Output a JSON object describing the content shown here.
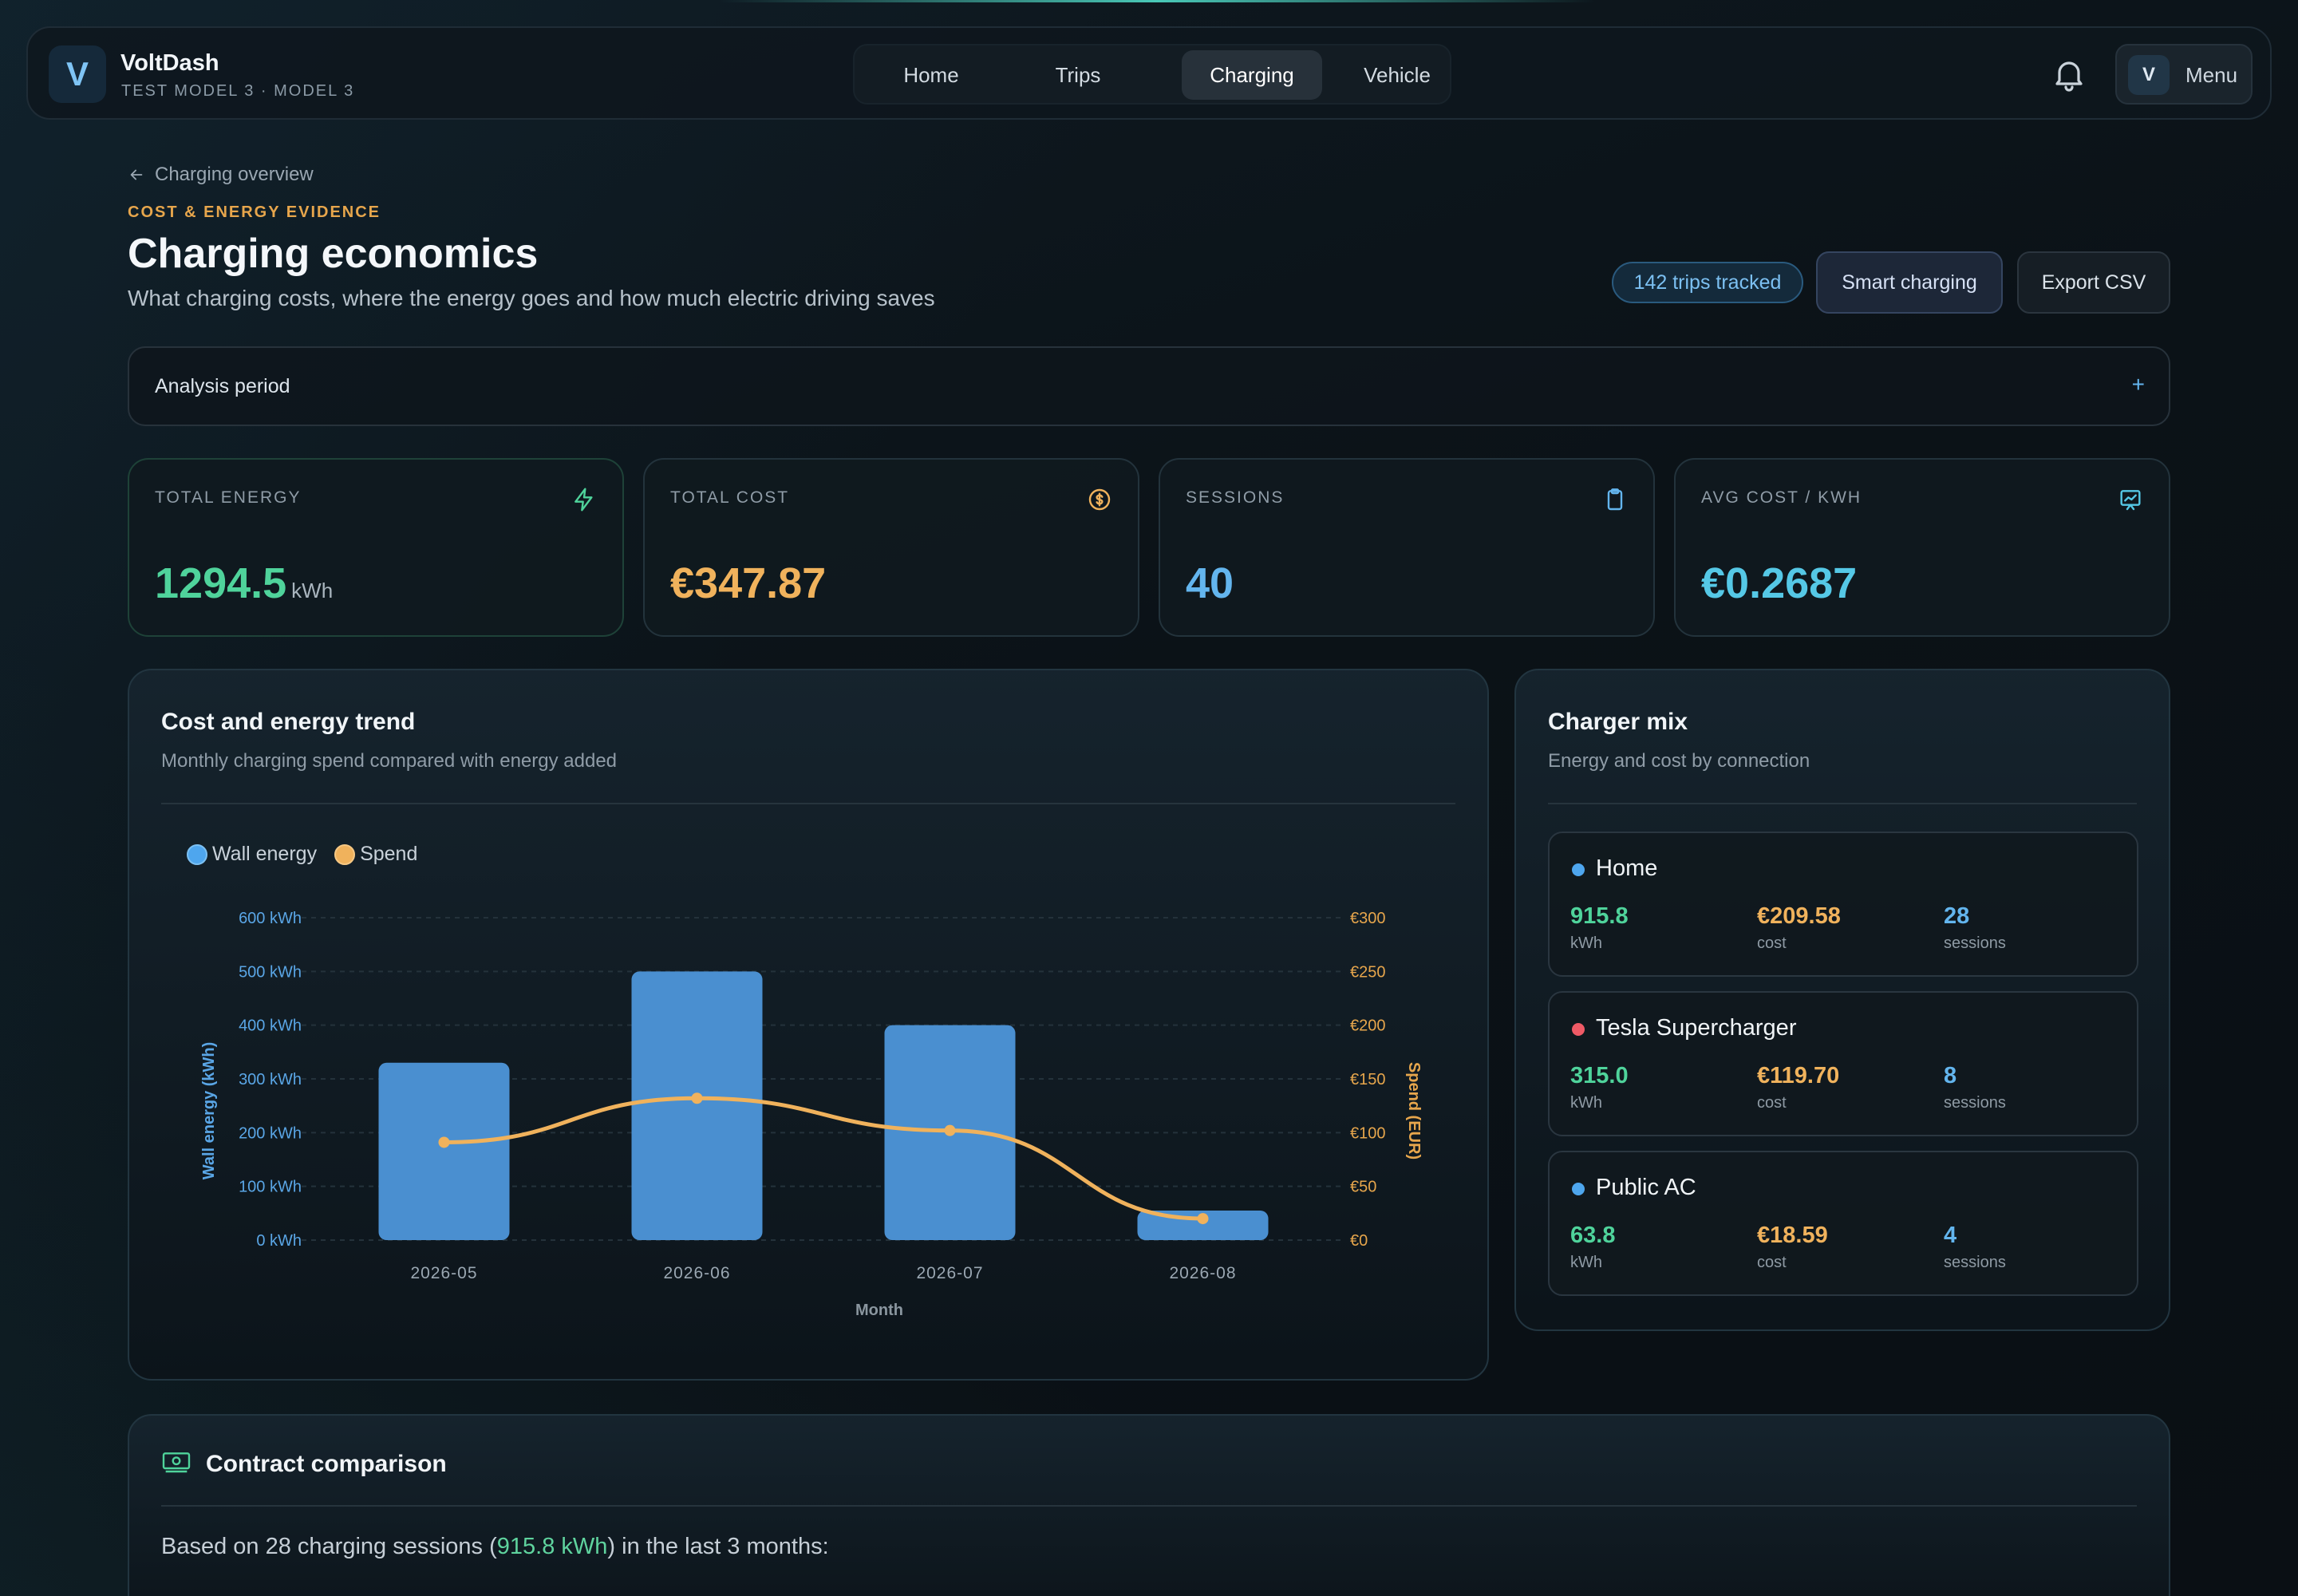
{
  "app": {
    "name": "VoltDash",
    "subtitle": "TEST MODEL 3 · MODEL 3",
    "logo_letter": "V"
  },
  "nav": {
    "tabs": [
      {
        "label": "Home",
        "active": false
      },
      {
        "label": "Trips",
        "active": false
      },
      {
        "label": "Charging",
        "active": true
      },
      {
        "label": "Vehicle",
        "active": false
      }
    ],
    "bell_icon": "bell-icon",
    "avatar_letter": "V",
    "menu_label": "Menu"
  },
  "header": {
    "breadcrumb": "Charging overview",
    "eyebrow": "COST & ENERGY EVIDENCE",
    "title": "Charging economics",
    "subtitle": "What charging costs, where the energy goes and how much electric driving saves",
    "trips_badge": "142 trips tracked",
    "smart_charging_label": "Smart charging",
    "export_label": "Export CSV"
  },
  "period": {
    "label": "Analysis period",
    "toggle": "+"
  },
  "kpis": [
    {
      "label": "TOTAL ENERGY",
      "value": "1294.5",
      "unit": "kWh",
      "color": "#4fd39b",
      "icon": "bolt-icon"
    },
    {
      "label": "TOTAL COST",
      "value": "€347.87",
      "unit": "",
      "color": "#f0b25c",
      "icon": "coin-icon"
    },
    {
      "label": "SESSIONS",
      "value": "40",
      "unit": "",
      "color": "#63b5ee",
      "icon": "clipboard-icon"
    },
    {
      "label": "AVG COST / KWH",
      "value": "€0.2687",
      "unit": "",
      "color": "#55c8e6",
      "icon": "chart-icon"
    }
  ],
  "trend": {
    "title": "Cost and energy trend",
    "subtitle": "Monthly charging spend compared with energy added"
  },
  "chart_data": {
    "type": "bar",
    "categories": [
      "2026-05",
      "2026-06",
      "2026-07",
      "2026-08"
    ],
    "series": [
      {
        "name": "Wall energy",
        "type": "bar",
        "axis": "left",
        "color": "#4a8fd0",
        "values": [
          330,
          500,
          400,
          55
        ]
      },
      {
        "name": "Spend",
        "type": "line",
        "axis": "right",
        "color": "#f0b25c",
        "values": [
          91,
          132,
          102,
          20
        ]
      }
    ],
    "xlabel": "Month",
    "ylabel": "Wall energy (kWh)",
    "y2label": "Spend (EUR)",
    "ylim": [
      0,
      600
    ],
    "y2lim": [
      0,
      300
    ],
    "y_ticks": [
      "0 kWh",
      "100 kWh",
      "200 kWh",
      "300 kWh",
      "400 kWh",
      "500 kWh",
      "600 kWh"
    ],
    "y2_ticks": [
      "€0",
      "€50",
      "€100",
      "€150",
      "€200",
      "€250",
      "€300"
    ],
    "legend_position": "top-left",
    "grid": true
  },
  "mix": {
    "title": "Charger mix",
    "subtitle": "Energy and cost by connection",
    "chargers": [
      {
        "name": "Home",
        "dot_color": "#4ea6ee",
        "kwh": "915.8",
        "kwh_label": "kWh",
        "cost": "€209.58",
        "cost_label": "cost",
        "sessions": "28",
        "sessions_label": "sessions"
      },
      {
        "name": "Tesla Supercharger",
        "dot_color": "#ef5a66",
        "kwh": "315.0",
        "kwh_label": "kWh",
        "cost": "€119.70",
        "cost_label": "cost",
        "sessions": "8",
        "sessions_label": "sessions"
      },
      {
        "name": "Public AC",
        "dot_color": "#4ea6ee",
        "kwh": "63.8",
        "kwh_label": "kWh",
        "cost": "€18.59",
        "cost_label": "cost",
        "sessions": "4",
        "sessions_label": "sessions"
      }
    ]
  },
  "contract": {
    "title": "Contract comparison",
    "text_prefix": "Based on 28 charging sessions (",
    "text_highlight": "915.8 kWh",
    "text_suffix": ") in the last 3 months:"
  }
}
